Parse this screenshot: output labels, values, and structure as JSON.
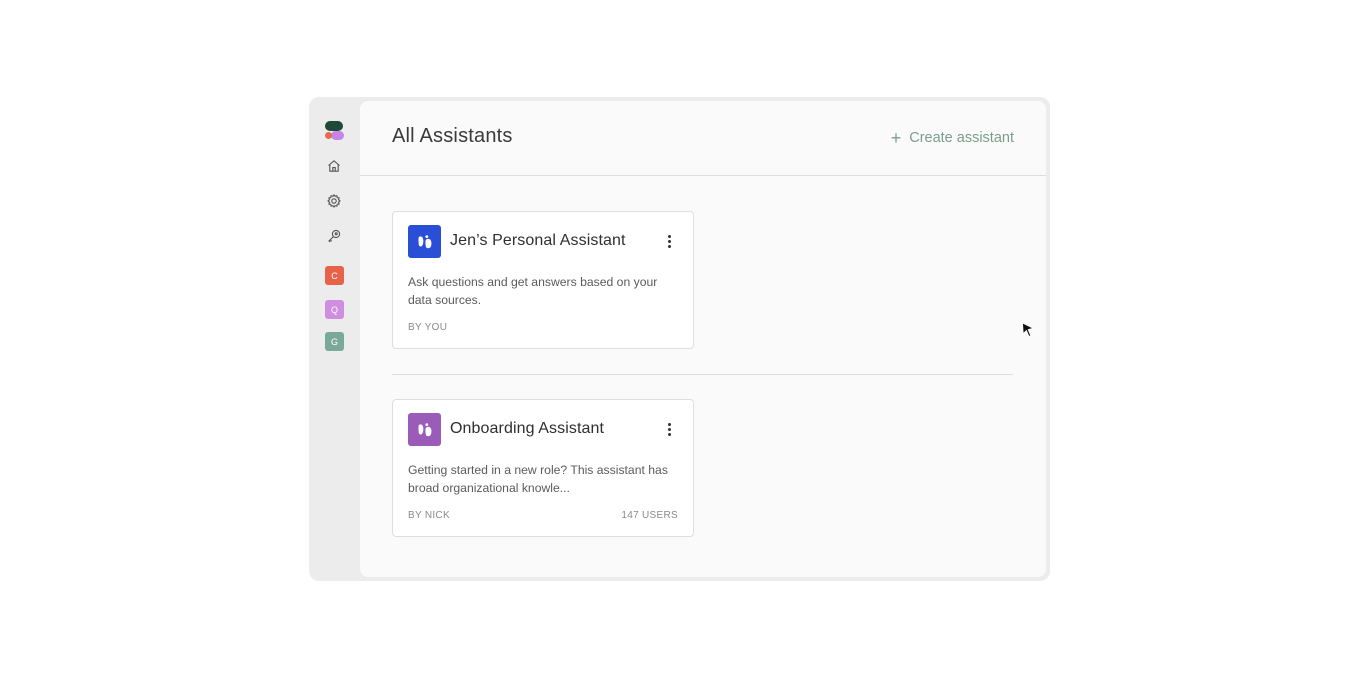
{
  "app": {
    "sidebar": {
      "icons": [
        {
          "name": "home-icon"
        },
        {
          "name": "gear-icon"
        },
        {
          "name": "key-icon"
        }
      ],
      "spaces": [
        {
          "letter": "C",
          "color": "#e8624a"
        },
        {
          "letter": "Q",
          "color": "#d08ee0"
        },
        {
          "letter": "G",
          "color": "#7aa899"
        }
      ]
    },
    "header": {
      "title": "All Assistants",
      "create_label": "Create assistant",
      "create_icon": "plus-icon"
    },
    "assistants": [
      {
        "name": "Jen’s Personal Assistant",
        "description": "Ask questions and get answers based on your data sources.",
        "author": "BY YOU",
        "users": "",
        "avatar_color": "#2a4fd6"
      },
      {
        "name": "Onboarding Assistant",
        "description": "Getting started in a new role? This assistant has broad organizational knowle...",
        "author": "BY NICK",
        "users": "147 USERS",
        "avatar_color": "#9a5cb8"
      }
    ],
    "colors": {
      "accent": "#7a9e8c",
      "logo_dark": "#1f4a3a",
      "logo_orange": "#e86a4a",
      "logo_purple": "#c585e8"
    }
  }
}
